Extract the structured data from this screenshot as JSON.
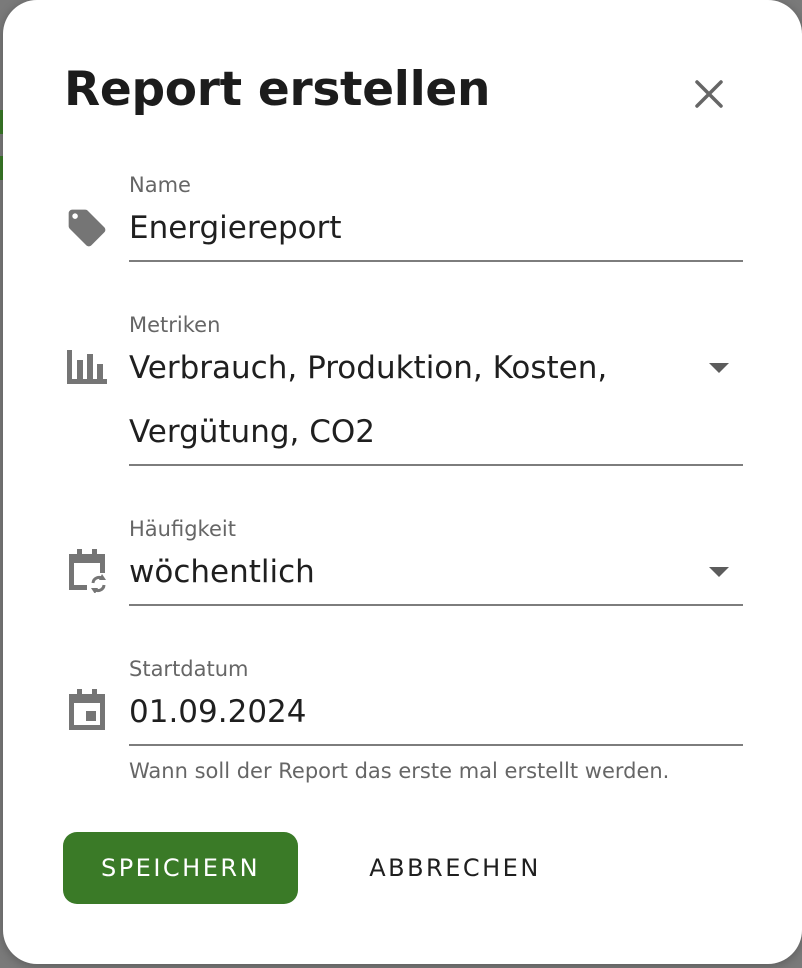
{
  "dialog": {
    "title": "Report erstellen",
    "close_icon": "close-icon"
  },
  "fields": {
    "name": {
      "label": "Name",
      "value": "Energiereport",
      "icon": "tag-icon"
    },
    "metrics": {
      "label": "Metriken",
      "value_line1": "Verbrauch, Produktion, Kosten,",
      "value_line2": "Vergütung, CO2",
      "icon": "bar-chart-icon"
    },
    "frequency": {
      "label": "Häufigkeit",
      "value": "wöchentlich",
      "icon": "calendar-sync-icon"
    },
    "start_date": {
      "label": "Startdatum",
      "value": "01.09.2024",
      "helper": "Wann soll der Report das erste mal erstellt werden.",
      "icon": "calendar-icon"
    }
  },
  "actions": {
    "save_label": "SPEICHERN",
    "cancel_label": "ABBRECHEN"
  },
  "colors": {
    "primary": "#3a7a27",
    "text": "#1f1f1f",
    "label": "#666666",
    "icon": "#757575"
  }
}
